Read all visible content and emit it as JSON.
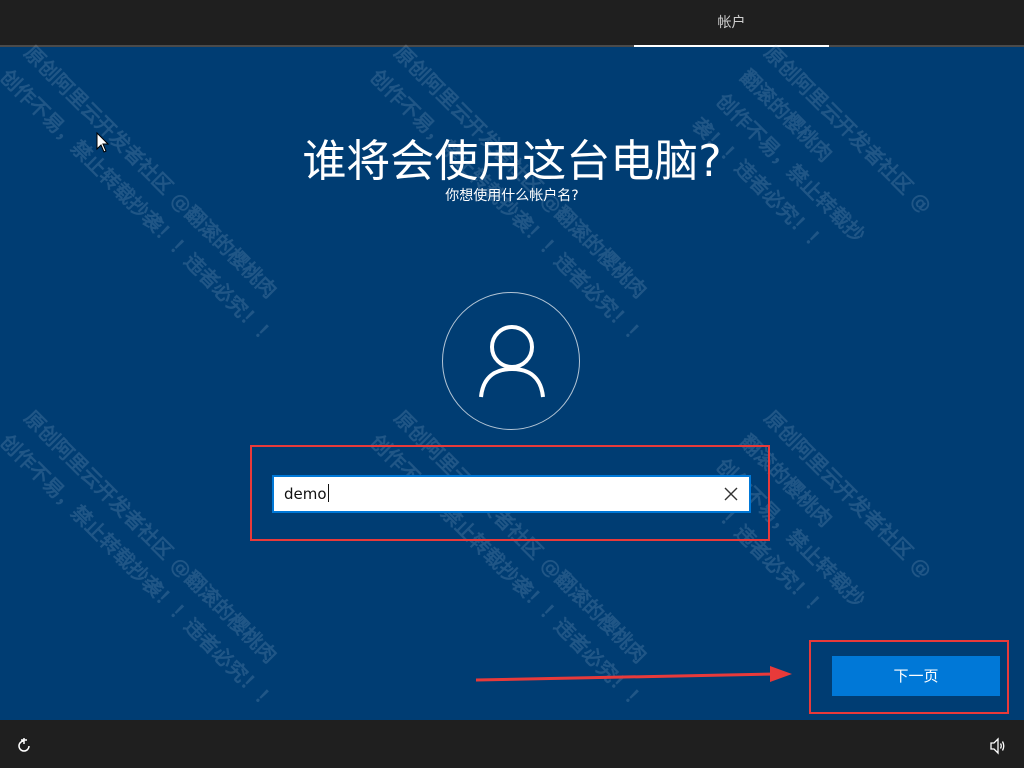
{
  "header": {
    "tab_account": "帐户"
  },
  "main": {
    "title": "谁将会使用这台电脑?",
    "subtitle": "你想使用什么帐户名?",
    "avatar_icon": "user-icon",
    "username_input": {
      "value": "demo",
      "clear_icon": "close-icon"
    },
    "next_button": "下一页"
  },
  "watermark": {
    "text": "原创阿里云开发者社区 @翻滚的樱桃肉\n创作不易，禁止转载抄袭！！违者必究！！"
  },
  "footer": {
    "ease_of_access_icon": "ease-of-access-icon",
    "volume_icon": "volume-icon"
  },
  "colors": {
    "background": "#003d73",
    "accent": "#0078d7",
    "annotation_red": "#e83a3a"
  }
}
